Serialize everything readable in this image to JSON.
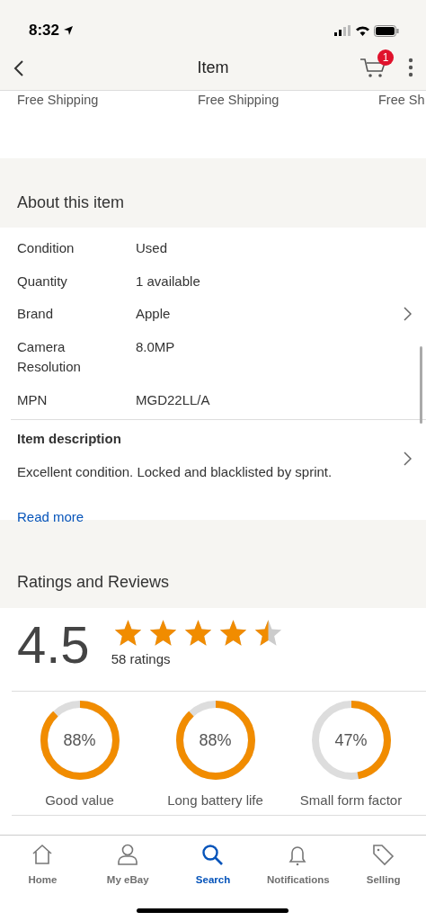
{
  "status_bar": {
    "time": "8:32"
  },
  "nav": {
    "title": "Item",
    "cart_badge": "1"
  },
  "shipping": [
    "Free Shipping",
    "Free Shipping",
    "Free Sh"
  ],
  "about": {
    "title": "About this item",
    "specs": [
      {
        "label": "Condition",
        "value": "Used"
      },
      {
        "label": "Quantity",
        "value": "1 available"
      },
      {
        "label": "Brand",
        "value": "Apple"
      },
      {
        "label": "Camera Resolution",
        "value": "8.0MP"
      },
      {
        "label": "MPN",
        "value": "MGD22LL/A"
      }
    ],
    "description_title": "Item description",
    "description": "Excellent condition. Locked and blacklisted by sprint.",
    "read_more": "Read more"
  },
  "ratings": {
    "title": "Ratings and Reviews",
    "score": "4.5",
    "stars": 4.5,
    "count": "58 ratings",
    "aspects": [
      {
        "percent": "88%",
        "level": 0.88,
        "label": "Good value"
      },
      {
        "percent": "88%",
        "level": 0.88,
        "label": "Long battery life"
      },
      {
        "percent": "47%",
        "level": 0.47,
        "label": "Small form factor"
      }
    ]
  },
  "tab_bar": [
    {
      "kind": "home",
      "label": "Home",
      "selected": false
    },
    {
      "kind": "person",
      "label": "My eBay",
      "selected": false
    },
    {
      "kind": "search",
      "label": "Search",
      "selected": true
    },
    {
      "kind": "bell",
      "label": "Notifications",
      "selected": false
    },
    {
      "kind": "tag",
      "label": "Selling",
      "selected": false
    }
  ]
}
